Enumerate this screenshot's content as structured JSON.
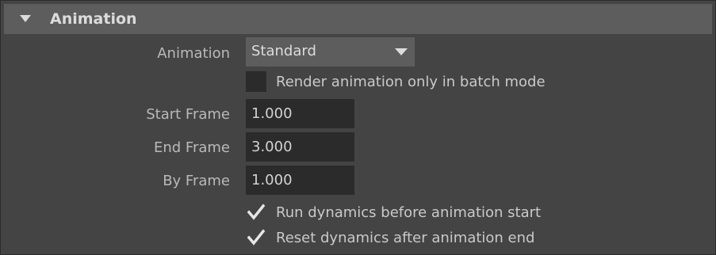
{
  "section": {
    "title": "Animation"
  },
  "animation": {
    "label": "Animation",
    "value": "Standard"
  },
  "render_batch": {
    "label": "Render animation only in batch mode",
    "checked": false
  },
  "start_frame": {
    "label": "Start Frame",
    "value": "1.000"
  },
  "end_frame": {
    "label": "End Frame",
    "value": "3.000"
  },
  "by_frame": {
    "label": "By Frame",
    "value": "1.000"
  },
  "run_dynamics": {
    "label": "Run dynamics before animation start",
    "checked": true
  },
  "reset_dynamics": {
    "label": "Reset dynamics after animation end",
    "checked": true
  },
  "colors": {
    "panel_bg": "#444444",
    "header_bg": "#5d5d5d",
    "field_bg": "#2b2b2b",
    "text": "#bbbbbb",
    "text_bright": "#dcdcdc"
  }
}
